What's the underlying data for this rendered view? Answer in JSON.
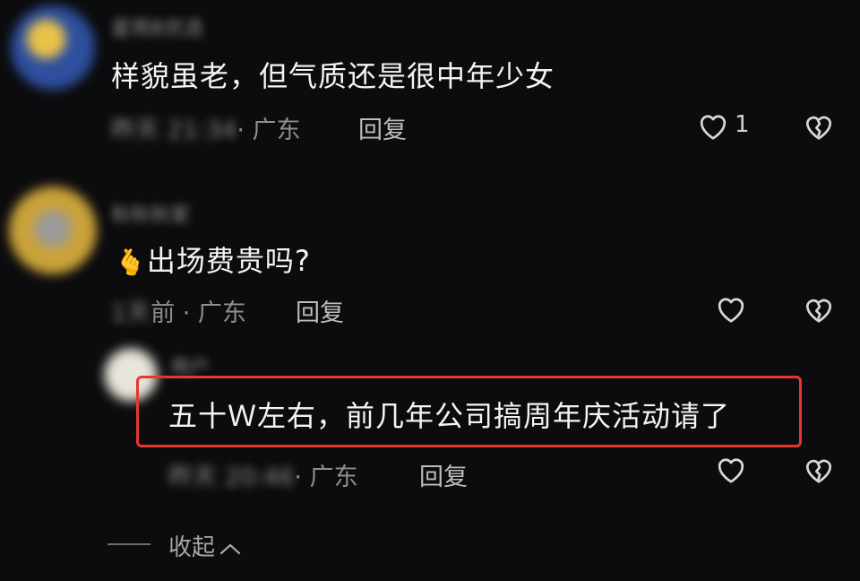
{
  "comments": [
    {
      "user": "星雨B优选",
      "text": "样貌虽老，但气质还是很中年少女",
      "time_blurred": "昨天 21:34",
      "location": "· 广东",
      "reply_label": "回复",
      "like_count": "1"
    },
    {
      "user": "秋秋秋家",
      "emoji": "🫰",
      "text": "出场费贵吗?",
      "time_blurred": "1天",
      "time_suffix": "前 · 广东",
      "reply_label": "回复"
    },
    {
      "user": "用户",
      "text": "五十Ｗ左右，前几年公司搞周年庆活动请了",
      "time_blurred": "昨天 20:46",
      "location": "· 广东",
      "reply_label": "回复"
    }
  ],
  "collapse_label": "收起",
  "colors": {
    "background": "#0c0c0e",
    "highlight": "#e6372f"
  }
}
